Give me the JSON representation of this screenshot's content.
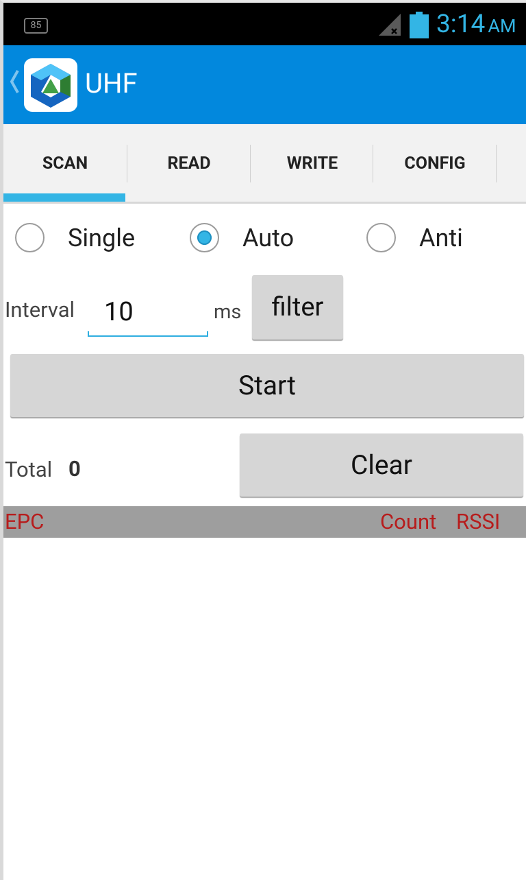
{
  "status_bar": {
    "notification_badge": "85",
    "time": "3:14",
    "ampm": "AM",
    "signal_icon": "signal-no-service-icon",
    "battery_icon": "battery-icon"
  },
  "action_bar": {
    "title": "UHF",
    "back_icon": "chevron-left-icon",
    "logo_icon": "app-logo-icon",
    "color": "#0288dd"
  },
  "tabs": [
    {
      "label": "SCAN",
      "selected": true
    },
    {
      "label": "READ",
      "selected": false
    },
    {
      "label": "WRITE",
      "selected": false
    },
    {
      "label": "CONFIG",
      "selected": false
    }
  ],
  "mode": {
    "options": [
      {
        "label": "Single",
        "checked": false
      },
      {
        "label": "Auto",
        "checked": true
      },
      {
        "label": "Anti",
        "checked": false
      }
    ]
  },
  "interval": {
    "label": "Interval",
    "value": "10",
    "unit": "ms"
  },
  "buttons": {
    "filter": "filter",
    "start": "Start",
    "clear": "Clear"
  },
  "total": {
    "label": "Total",
    "value": "0"
  },
  "list_header": {
    "epc": "EPC",
    "count": "Count",
    "rssi": "RSSI",
    "text_color": "#b71c1c"
  },
  "colors": {
    "accent": "#33b5e5",
    "header_bg": "#9e9e9e"
  }
}
